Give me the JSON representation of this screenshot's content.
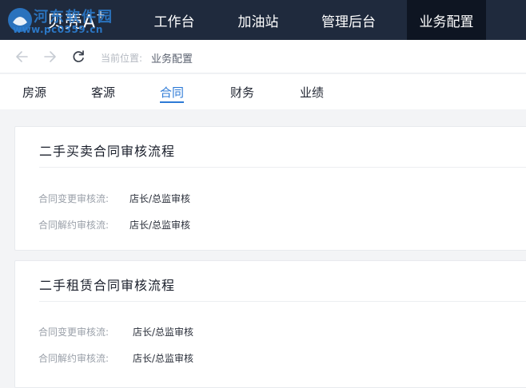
{
  "header": {
    "logo_text": "贝壳A",
    "logo_sup": "+",
    "watermark_line1": "河东软件园",
    "watermark_line2": "www.pc0359.cn",
    "nav": [
      {
        "label": "工作台"
      },
      {
        "label": "加油站"
      },
      {
        "label": "管理后台"
      },
      {
        "label": "业务配置"
      }
    ],
    "active_index": 3
  },
  "toolbar": {
    "back_icon": "arrow-left-icon",
    "forward_icon": "arrow-right-icon",
    "refresh_icon": "refresh-icon",
    "crumb_label": "当前位置:",
    "crumb_current": "业务配置"
  },
  "subnav": {
    "tabs": [
      {
        "label": "房源"
      },
      {
        "label": "客源"
      },
      {
        "label": "合同"
      },
      {
        "label": "财务"
      },
      {
        "label": "业绩"
      }
    ],
    "active_index": 2
  },
  "sections": [
    {
      "title": "二手买卖合同审核流程",
      "rows": [
        {
          "label": "合同变更审核流:",
          "value": "店长/总监审核"
        },
        {
          "label": "合同解约审核流:",
          "value": "店长/总监审核"
        }
      ]
    },
    {
      "title": "二手租赁合同审核流程",
      "rows": [
        {
          "label": "合同变更审核流:",
          "value": "店长/总监审核"
        },
        {
          "label": "合同解约审核流:",
          "value": "店长/总监审核"
        }
      ]
    }
  ],
  "colors": {
    "topbar_bg": "#1f2a3d",
    "active_nav_bg": "#0e1522",
    "accent": "#2d7ad6"
  }
}
